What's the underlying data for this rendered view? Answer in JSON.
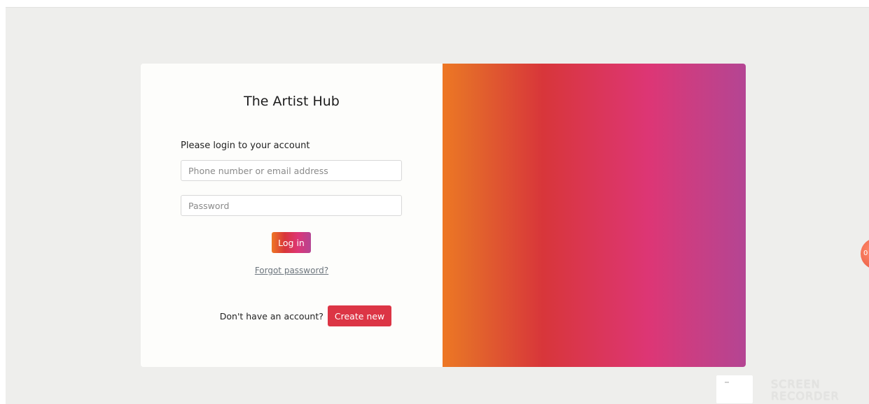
{
  "login_card": {
    "title": "The Artist Hub",
    "subtitle": "Please login to your account",
    "email_placeholder": "Phone number or email address",
    "password_placeholder": "Password",
    "login_label": "Log in",
    "forgot_label": "Forgot password?",
    "signup_prompt": "Don't have an account?",
    "create_label": "Create new"
  },
  "overlay": {
    "recorder_bubble_text": "0",
    "watermark_line1": "SCREEN",
    "watermark_line2": "RECORDER"
  },
  "colors": {
    "gradient_stops": [
      "#ee7724",
      "#d8363a",
      "#dd3675",
      "#b44593"
    ],
    "create_button": "#dc3545",
    "page_background": "#eeeeec"
  }
}
